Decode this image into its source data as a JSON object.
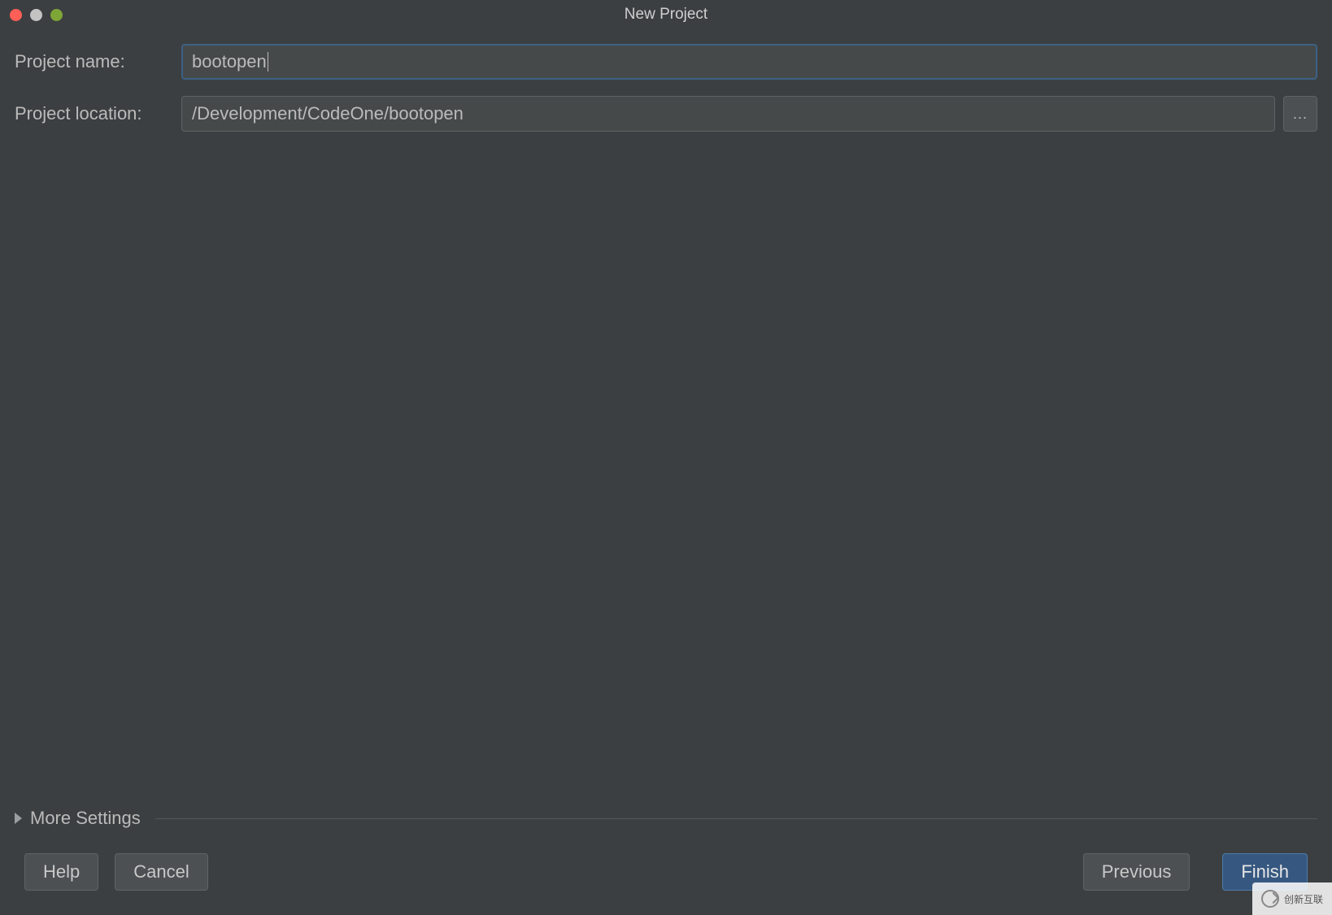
{
  "window": {
    "title": "New Project"
  },
  "form": {
    "project_name_label": "Project name:",
    "project_name_value": "bootopen",
    "project_location_label": "Project location:",
    "project_location_value": "/Development/CodeOne/bootopen",
    "browse_button_label": "..."
  },
  "more_settings": {
    "label": "More Settings",
    "expanded": false
  },
  "buttons": {
    "help": "Help",
    "cancel": "Cancel",
    "previous": "Previous",
    "finish": "Finish"
  },
  "watermark": {
    "text": "创新互联"
  }
}
